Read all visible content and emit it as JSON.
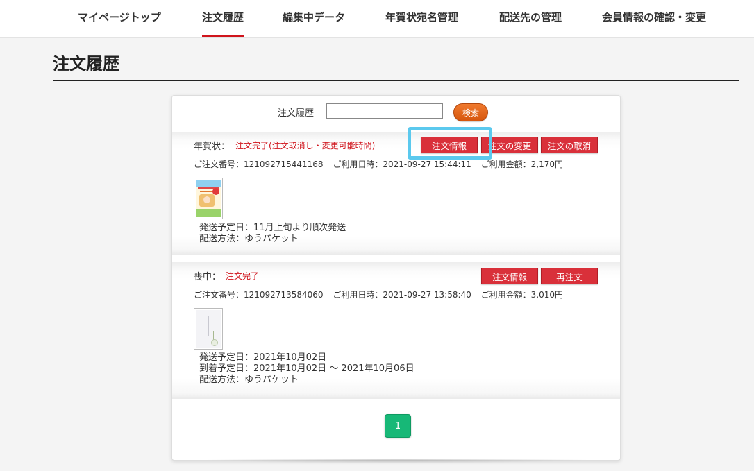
{
  "nav": {
    "items": [
      {
        "label": "マイページトップ",
        "active": false
      },
      {
        "label": "注文履歴",
        "active": true
      },
      {
        "label": "編集中データ",
        "active": false
      },
      {
        "label": "年賀状宛名管理",
        "active": false
      },
      {
        "label": "配送先の管理",
        "active": false
      },
      {
        "label": "会員情報の確認・変更",
        "active": false
      }
    ]
  },
  "page": {
    "title": "注文履歴"
  },
  "search": {
    "label": "注文履歴",
    "value": "",
    "placeholder": "",
    "button_label": "検索"
  },
  "orders": [
    {
      "type_label": "年賀状：",
      "status": "注文完了(注文取消し・変更可能時間)",
      "buttons": [
        "注文情報",
        "注文の変更",
        "注文の取消"
      ],
      "order_number": "ご注文番号：121092715441168",
      "usage_date": "ご利用日時：2021-09-27 15:44:11",
      "amount": "ご利用金額：2,170円",
      "shipping_lines": [
        "発送予定日：11月上旬より順次発送",
        "配送方法：ゆうパケット"
      ]
    },
    {
      "type_label": "喪中：",
      "status": "注文完了",
      "buttons": [
        "注文情報",
        "再注文"
      ],
      "order_number": "ご注文番号：121092713584060",
      "usage_date": "ご利用日時：2021-09-27 13:58:40",
      "amount": "ご利用金額：3,010円",
      "shipping_lines": [
        "発送予定日：2021年10月02日",
        "到着予定日：2021年10月02日 ～ 2021年10月06日",
        "配送方法：ゆうパケット"
      ]
    }
  ],
  "pagination": {
    "current": "1"
  },
  "colors": {
    "accent": "#d0141c",
    "search_button": "#e4641c",
    "page_button": "#17b877",
    "highlight": "#5bc9ee"
  }
}
